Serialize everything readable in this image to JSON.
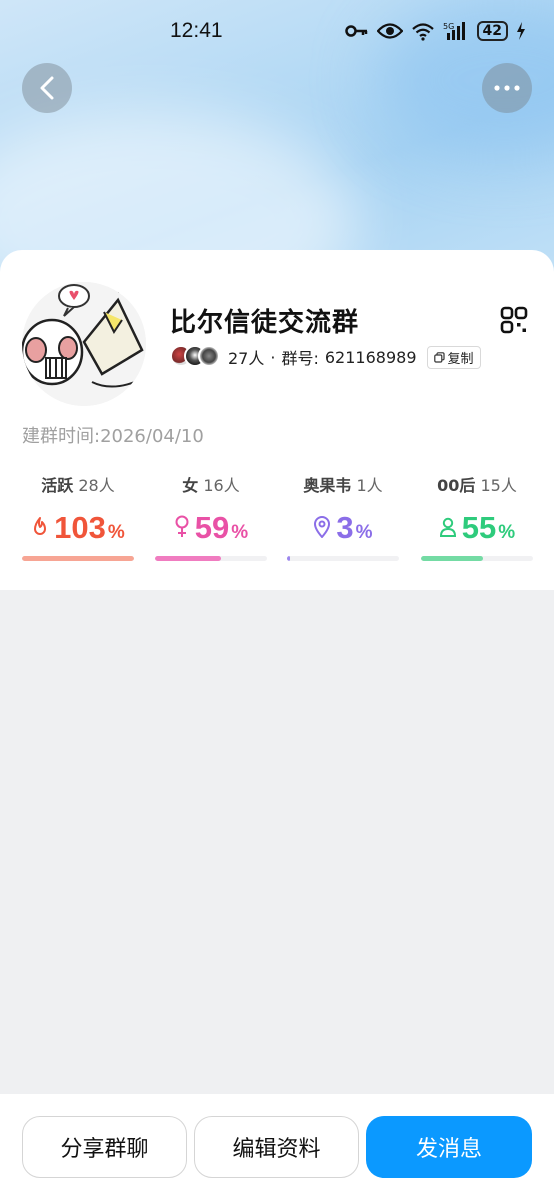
{
  "status_bar": {
    "time": "12:41",
    "battery": "42"
  },
  "group": {
    "name": "比尔信徒交流群",
    "member_count": "27人",
    "separator": "·",
    "id_label": "群号:",
    "id_value": "621168989",
    "copy_label": "复制",
    "created_label": "建群时间:",
    "created_value": "2026/04/10"
  },
  "stats": [
    {
      "label": "活跃",
      "count": "28人",
      "value": "103",
      "unit": "%",
      "icon": "flame-icon",
      "color": "#f0553a",
      "bar_color": "#f7a594",
      "fill": 1.0
    },
    {
      "label": "女",
      "count": "16人",
      "value": "59",
      "unit": "%",
      "icon": "female-icon",
      "color": "#e951a6",
      "bar_color": "#f07cc0",
      "fill": 0.59
    },
    {
      "label": "奥果韦",
      "count": "1人",
      "value": "3",
      "unit": "%",
      "icon": "location-pin-icon",
      "color": "#8b6ee8",
      "bar_color": "#9c86ee",
      "fill": 0.03
    },
    {
      "label": "00后",
      "count": "15人",
      "value": "55",
      "unit": "%",
      "icon": "person-icon",
      "color": "#2ecb7c",
      "bar_color": "#74dba4",
      "fill": 0.55
    }
  ],
  "actions": {
    "share": "分享群聊",
    "edit": "编辑资料",
    "message": "发消息"
  }
}
